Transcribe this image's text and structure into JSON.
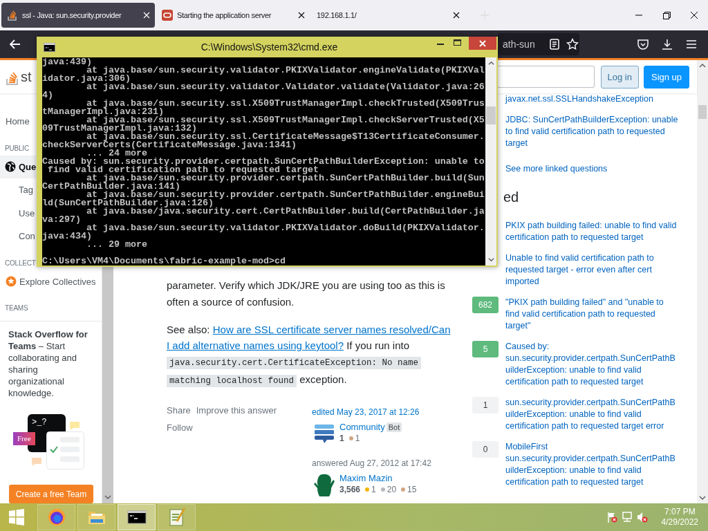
{
  "browser": {
    "tabs": [
      {
        "title": "ssl - Java: sun.security.provider",
        "selected": true
      },
      {
        "title": "Starting the application server",
        "selected": false
      },
      {
        "title": "192.168.1.1/",
        "selected": false
      }
    ],
    "address_fragment": "ath-sun"
  },
  "page": {
    "logo_fragment": "st",
    "login": "Log in",
    "signup": "Sign up",
    "sidebar": [
      {
        "kind": "link",
        "label": "Home",
        "selected": false
      },
      {
        "kind": "heading",
        "label": "PUBLIC"
      },
      {
        "kind": "link",
        "label": "Que",
        "selected": true
      },
      {
        "kind": "sublink",
        "label": "Tag",
        "selected": false
      },
      {
        "kind": "sublink",
        "label": "Use",
        "selected": false
      },
      {
        "kind": "sublink",
        "label": "Con",
        "selected": false
      },
      {
        "kind": "heading",
        "label": "COLLECT"
      },
      {
        "kind": "link",
        "label": "Explore Collectives",
        "selected": false
      },
      {
        "kind": "heading",
        "label": "TEAMS"
      }
    ],
    "teams": {
      "text": "**Stack Overflow for Teams** – Start collaborating and sharing organizational knowledge.",
      "prompt": ">_?",
      "badge": "Free",
      "button": "Create a free Team"
    },
    "answer": {
      "paragraphs": [
        [
          {
            "kind": "text",
            "text": "parameter. Verify which JDK/JRE you are using too as this is often a source of confusion."
          }
        ],
        [
          {
            "kind": "text",
            "text": "See also: "
          },
          {
            "kind": "link",
            "text": "How are SSL certificate server names resolved/Can"
          },
          {
            "kind": "link",
            "text": "I add alternative names using keytool?"
          },
          {
            "kind": "text",
            "text": " If you run into "
          },
          {
            "kind": "code",
            "text": "java.security.cert.CertificateException: No name"
          },
          {
            "kind": "code",
            "text": "matching localhost found"
          },
          {
            "kind": "text",
            "text": " exception."
          }
        ]
      ],
      "menu": [
        "Share",
        "Improve this answer",
        "Follow"
      ],
      "cards": [
        {
          "action": "edited May 23, 2017 at 12:26",
          "kind": "edited",
          "name": "Community",
          "tag": "Bot",
          "rep": "1",
          "badges": [
            {
              "color": "#d1a684",
              "count": "1"
            }
          ]
        },
        {
          "action": "answered Aug 27, 2012 at 17:42",
          "kind": "answered",
          "name": "Maxim Mazin",
          "rep": "3,566",
          "badges": [
            {
              "color": "#f1b600",
              "count": "1"
            },
            {
              "color": "#b4b8bc",
              "count": "20"
            },
            {
              "color": "#d1a684",
              "count": "15"
            }
          ]
        }
      ]
    },
    "linked": [
      "javax.net.ssl.SSLHandshakeException",
      "JDBC: SunCertPathBuilderException: unable to find valid certification path to requested target"
    ],
    "see_more": "See more linked questions",
    "related_heading_fragment": "ed",
    "related": [
      {
        "title": "PKIX path building failed: unable to find valid certification path to requested target"
      },
      {
        "title": "Unable to find valid certification path to requested target - error even after cert imported"
      },
      {
        "score": "682",
        "accepted": true,
        "title": "\"PKIX path building failed\" and \"unable to find valid certification path to requested target\""
      },
      {
        "score": "5",
        "accepted": true,
        "title": "Caused by: sun.security.provider.certpath.SunCertPathBuilderException: unable to find valid certification path to requested target"
      },
      {
        "score": "1",
        "accepted": false,
        "title": "sun.security.provider.certpath.SunCertPathBuilderException: unable to find valid certification path to requested target error"
      },
      {
        "score": "0",
        "accepted": false,
        "title": "MobileFirst sun.security.provider.certpath.SunCertPathBuilderException: unable to find valid certification path to requested target"
      }
    ]
  },
  "console": {
    "title": "C:\\Windows\\System32\\cmd.exe",
    "lines": [
      "java:439)",
      "        at java.base/sun.security.validator.PKIXValidator.engineValidate(PKIXVal",
      "idator.java:306)",
      "        at java.base/sun.security.validator.Validator.validate(Validator.java:26",
      "4)",
      "        at java.base/sun.security.ssl.X509TrustManagerImpl.checkTrusted(X509Trus",
      "tManagerImpl.java:231)",
      "        at java.base/sun.security.ssl.X509TrustManagerImpl.checkServerTrusted(X5",
      "09TrustManagerImpl.java:132)",
      "        at java.base/sun.security.ssl.CertificateMessage$T13CertificateConsumer.",
      "checkServerCerts(CertificateMessage.java:1341)",
      "        ... 24 more",
      "Caused by: sun.security.provider.certpath.SunCertPathBuilderException: unable to",
      " find valid certification path to requested target",
      "        at java.base/sun.security.provider.certpath.SunCertPathBuilder.build(Sun",
      "CertPathBuilder.java:141)",
      "        at java.base/sun.security.provider.certpath.SunCertPathBuilder.engineBui",
      "ld(SunCertPathBuilder.java:126)",
      "        at java.base/java.security.cert.CertPathBuilder.build(CertPathBuilder.ja",
      "va:297)",
      "        at java.base/sun.security.validator.PKIXValidator.doBuild(PKIXValidator.",
      "java:434)",
      "        ... 29 more"
    ],
    "prompt": "C:\\Users\\VM4\\Documents\\fabric-example-mod>cd"
  },
  "taskbar": {
    "items": [
      {
        "kind": "start",
        "selected": false
      },
      {
        "kind": "firefox",
        "selected": false
      },
      {
        "kind": "explorer",
        "selected": false
      },
      {
        "kind": "cmd",
        "selected": true
      },
      {
        "kind": "notepad",
        "selected": false
      }
    ],
    "tray": [
      {
        "kind": "flag"
      },
      {
        "kind": "network"
      },
      {
        "kind": "volume"
      }
    ],
    "time": "7:07 PM",
    "date": "4/29/2022"
  }
}
